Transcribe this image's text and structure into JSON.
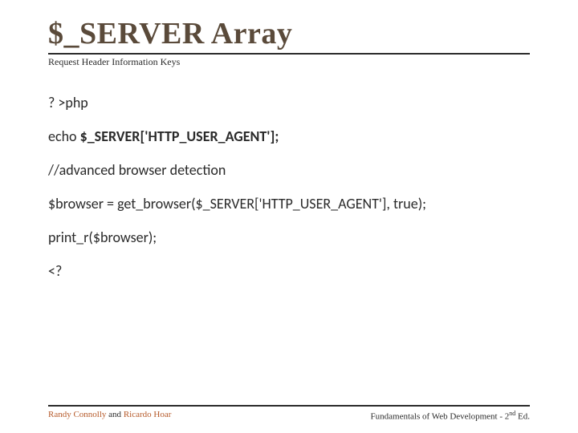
{
  "header": {
    "title": "$_SERVER Array",
    "subtitle": "Request Header Information Keys"
  },
  "code": {
    "line1": "? >php",
    "line2_prefix": "echo ",
    "line2_bold": "$_SERVER['HTTP_USER_AGENT']; ",
    "line3": "//advanced browser detection",
    "line4": "$browser = get_browser($_SERVER['HTTP_USER_AGENT'], true);",
    "line5": "print_r($browser);",
    "line6": "<?"
  },
  "footer": {
    "author1": "Randy Connolly",
    "joiner": " and ",
    "author2": "Ricardo Hoar",
    "book_prefix": "Fundamentals of Web Development - 2",
    "book_super": "nd",
    "book_suffix": " Ed."
  }
}
